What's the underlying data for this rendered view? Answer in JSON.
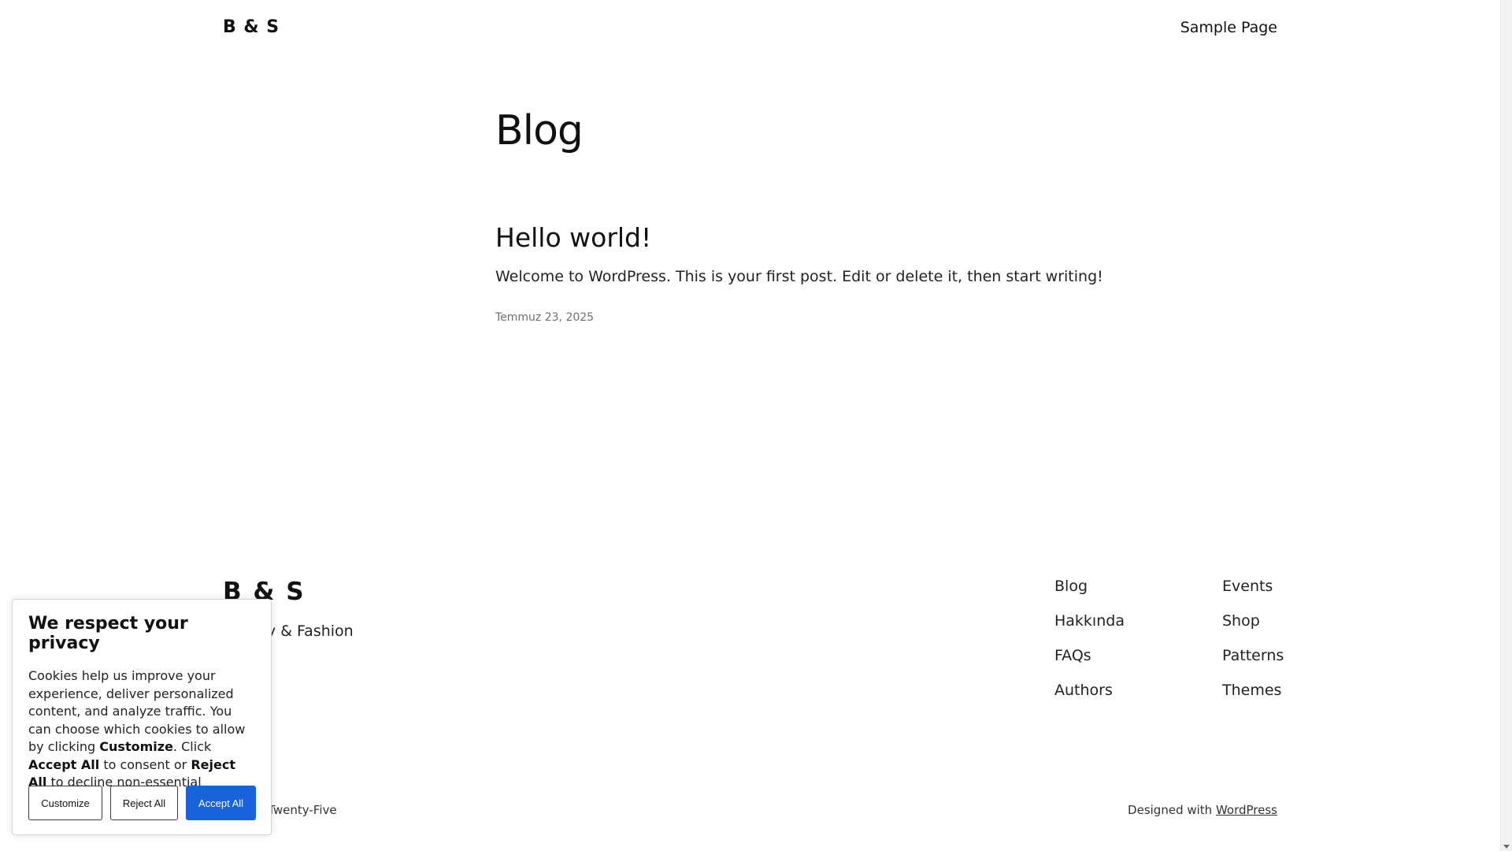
{
  "header": {
    "logo": "B & S",
    "nav_link": "Sample Page"
  },
  "main": {
    "page_title": "Blog",
    "post": {
      "title": "Hello world!",
      "excerpt": "Welcome to WordPress. This is your first post. Edit or delete it, then start writing!",
      "date": "Temmuz 23, 2025"
    }
  },
  "footer": {
    "logo": "B & S",
    "tagline": "Beauty & Fashion",
    "column_a": [
      "Blog",
      "Hakkında",
      "FAQs",
      "Authors"
    ],
    "column_b": [
      "Events",
      "Shop",
      "Patterns",
      "Themes"
    ],
    "theme_credit": "Twenty Twenty-Five",
    "designed_with_prefix": "Designed with ",
    "designed_with_link": "WordPress"
  },
  "cookie_banner": {
    "title": "We respect your privacy",
    "text_1": "Cookies help us improve your experience, deliver personalized content, and analyze traffic. You can choose which cookies to allow by clicking ",
    "bold_customize": "Customize",
    "text_2": ". Click ",
    "bold_accept": "Accept All",
    "text_3": " to consent or ",
    "bold_reject": "Reject All",
    "text_4": " to decline non-essential cookies.",
    "customize_button": "Customize",
    "reject_button": "Reject All",
    "accept_button": "Accept All"
  },
  "colors": {
    "accept_button": "#1863dc",
    "text": "#111111",
    "date_text": "#6f6f6f"
  }
}
